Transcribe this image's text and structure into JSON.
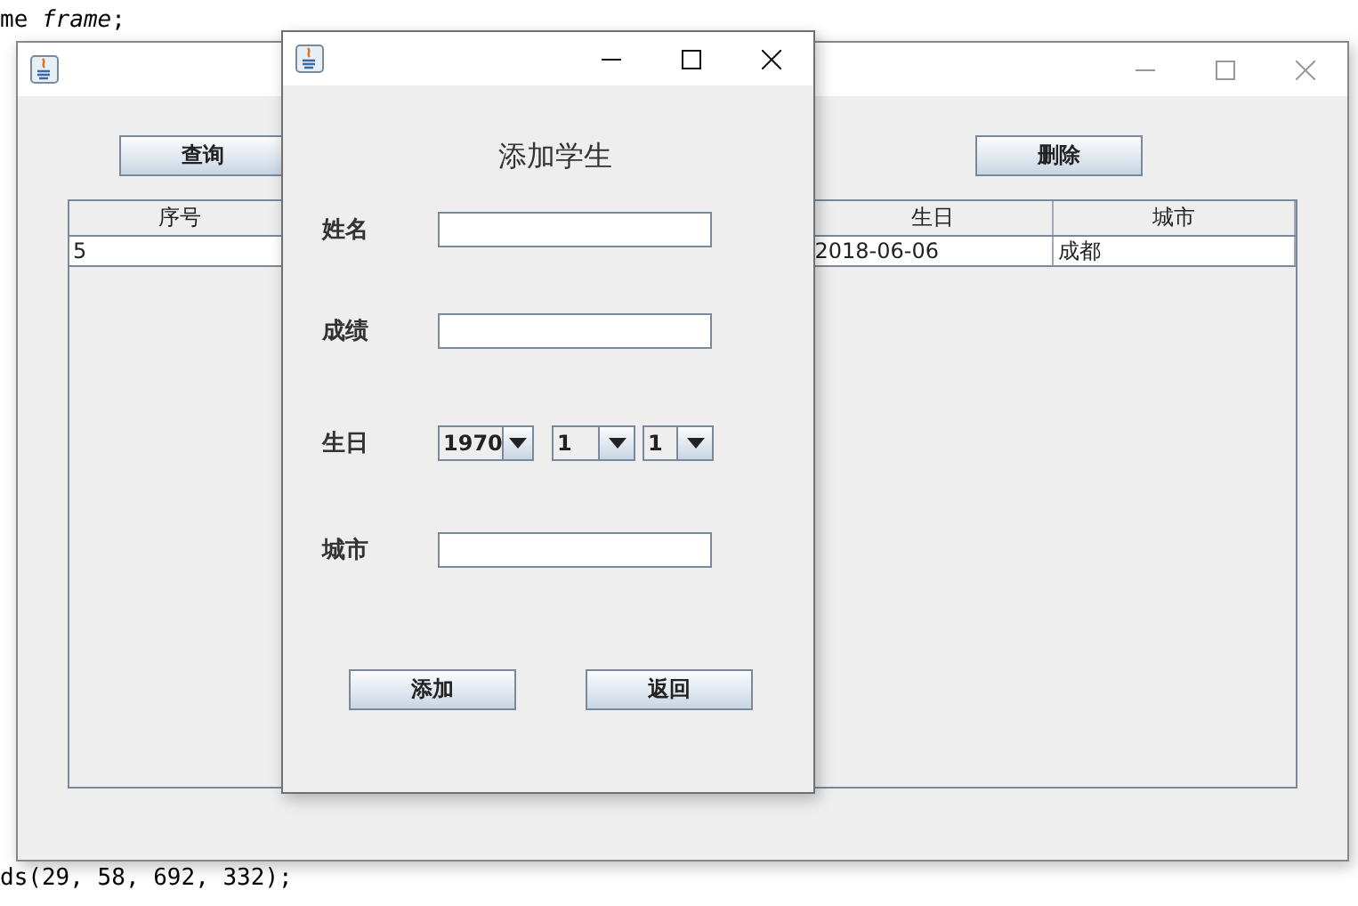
{
  "editor": {
    "top_lines": [
      "me *frame*;"
    ],
    "bottom_lines": [
      "ds(29, 58, 692, 332);"
    ]
  },
  "main_window": {
    "active": false,
    "buttons": [
      {
        "label": "查询"
      },
      {
        "label": "删除"
      }
    ],
    "table": {
      "columns": [
        "序号",
        "生日",
        "城市"
      ],
      "rows": [
        [
          "5",
          "2018-06-06",
          "成都"
        ]
      ]
    }
  },
  "dialog": {
    "active": true,
    "heading": "添加学生",
    "fields": [
      {
        "kind": "text",
        "label": "姓名"
      },
      {
        "kind": "text",
        "label": "成绩"
      },
      {
        "kind": "date",
        "label": "生日",
        "selects": [
          "1970",
          "1",
          "1"
        ]
      },
      {
        "kind": "text",
        "label": "城市"
      }
    ],
    "buttons": [
      {
        "label": "添加"
      },
      {
        "label": "返回"
      }
    ]
  }
}
